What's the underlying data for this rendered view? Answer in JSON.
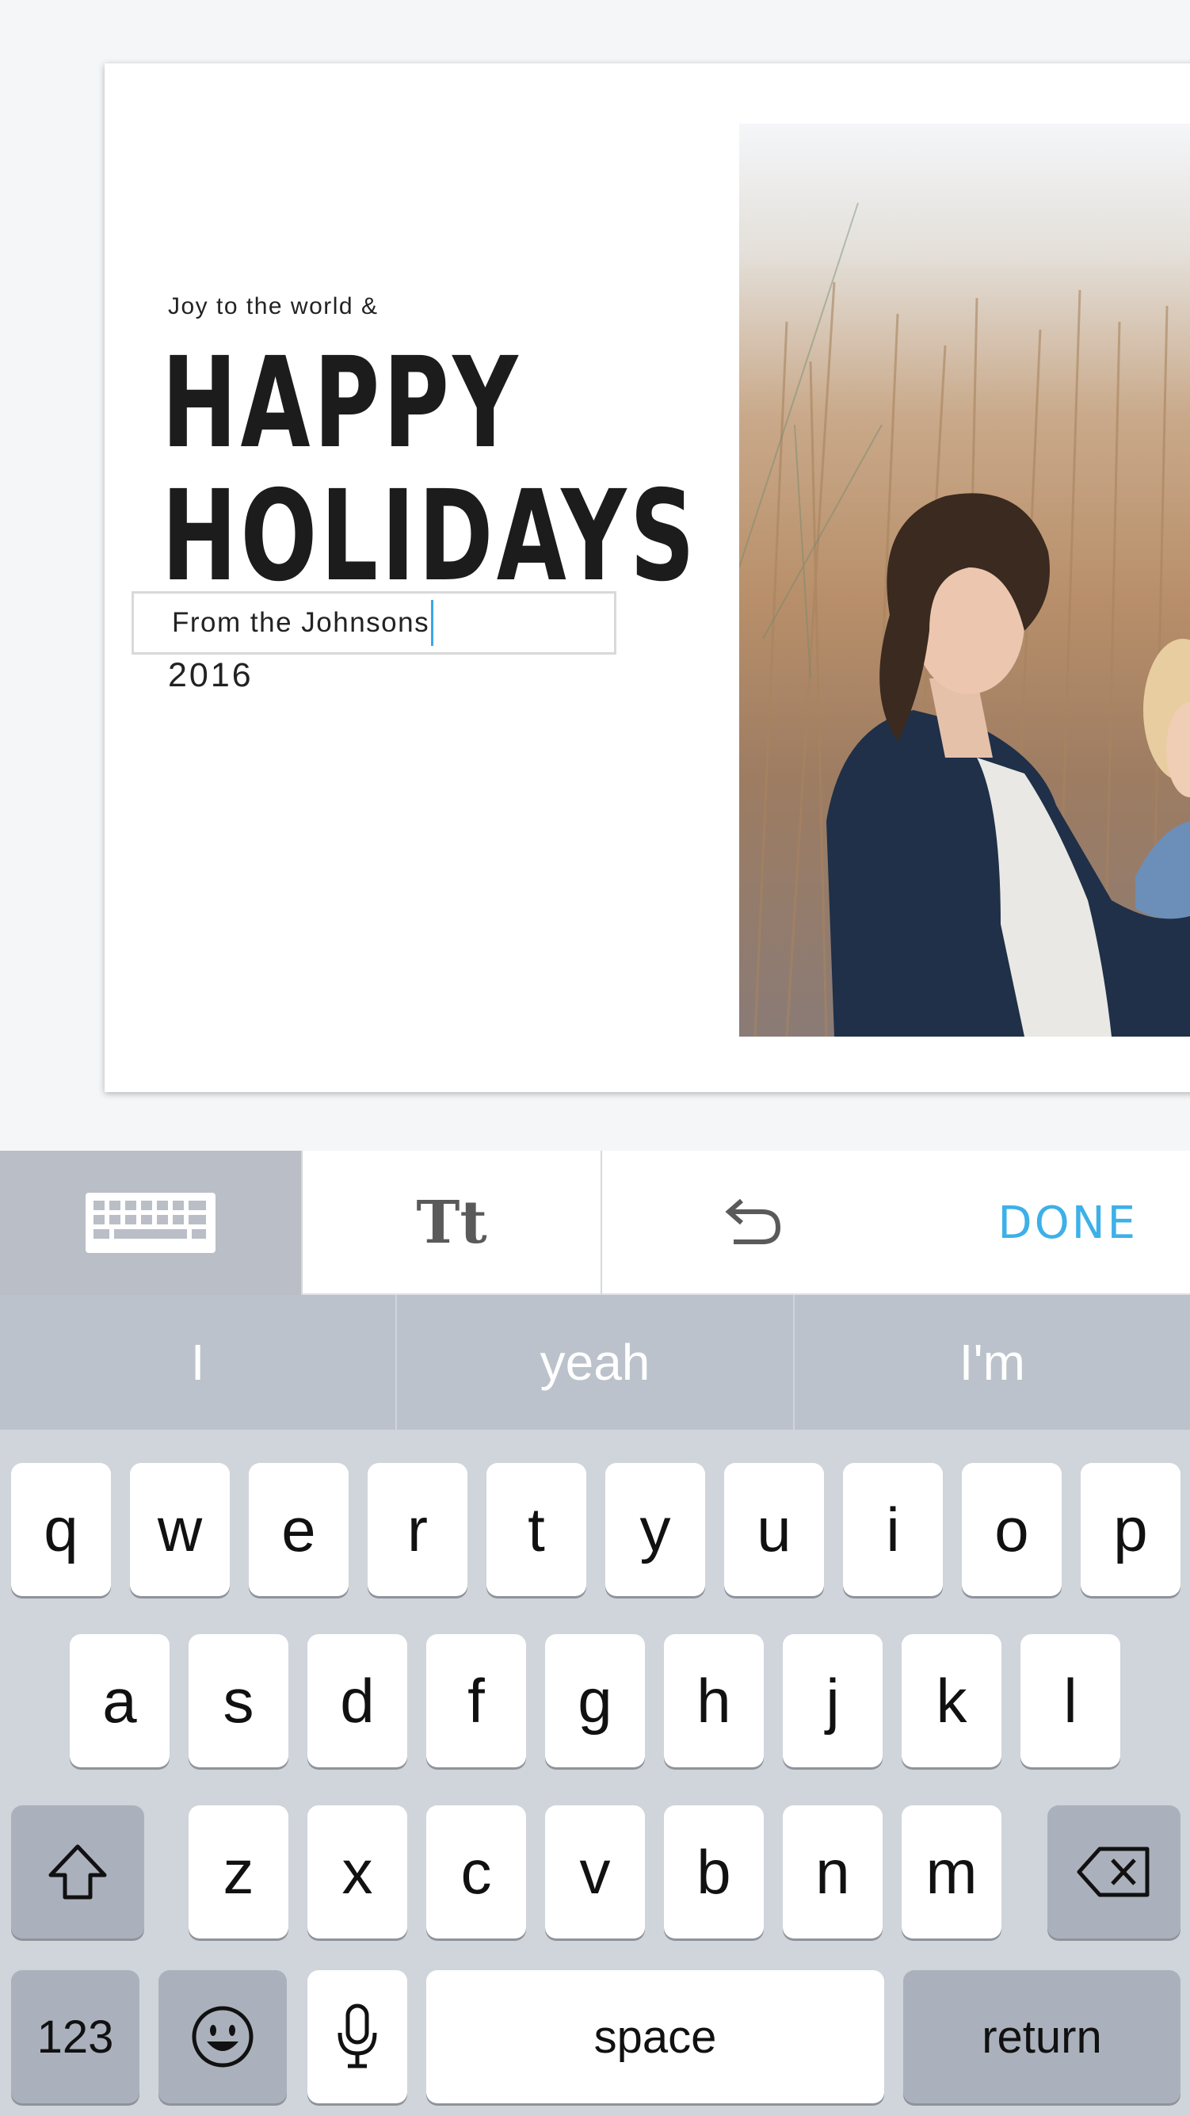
{
  "card": {
    "subtitle": "Joy to the world &",
    "headline_line1": "HAPPY",
    "headline_line2": "HOLIDAYS",
    "from_text": "From the Johnsons",
    "year": "2016"
  },
  "toolbar": {
    "keyboard_icon": "keyboard-icon",
    "text_style_label": "Tt",
    "undo_icon": "undo-icon",
    "done_label": "DONE",
    "accent_color": "#3db0e8"
  },
  "keyboard": {
    "suggestions": [
      "I",
      "yeah",
      "I'm"
    ],
    "row1": [
      "q",
      "w",
      "e",
      "r",
      "t",
      "y",
      "u",
      "i",
      "o",
      "p"
    ],
    "row2": [
      "a",
      "s",
      "d",
      "f",
      "g",
      "h",
      "j",
      "k",
      "l"
    ],
    "row3": [
      "z",
      "x",
      "c",
      "v",
      "b",
      "n",
      "m"
    ],
    "numbers_label": "123",
    "space_label": "space",
    "return_label": "return",
    "shift_icon": "shift-icon",
    "delete_icon": "delete-icon",
    "emoji_icon": "emoji-icon",
    "mic_icon": "microphone-icon"
  }
}
